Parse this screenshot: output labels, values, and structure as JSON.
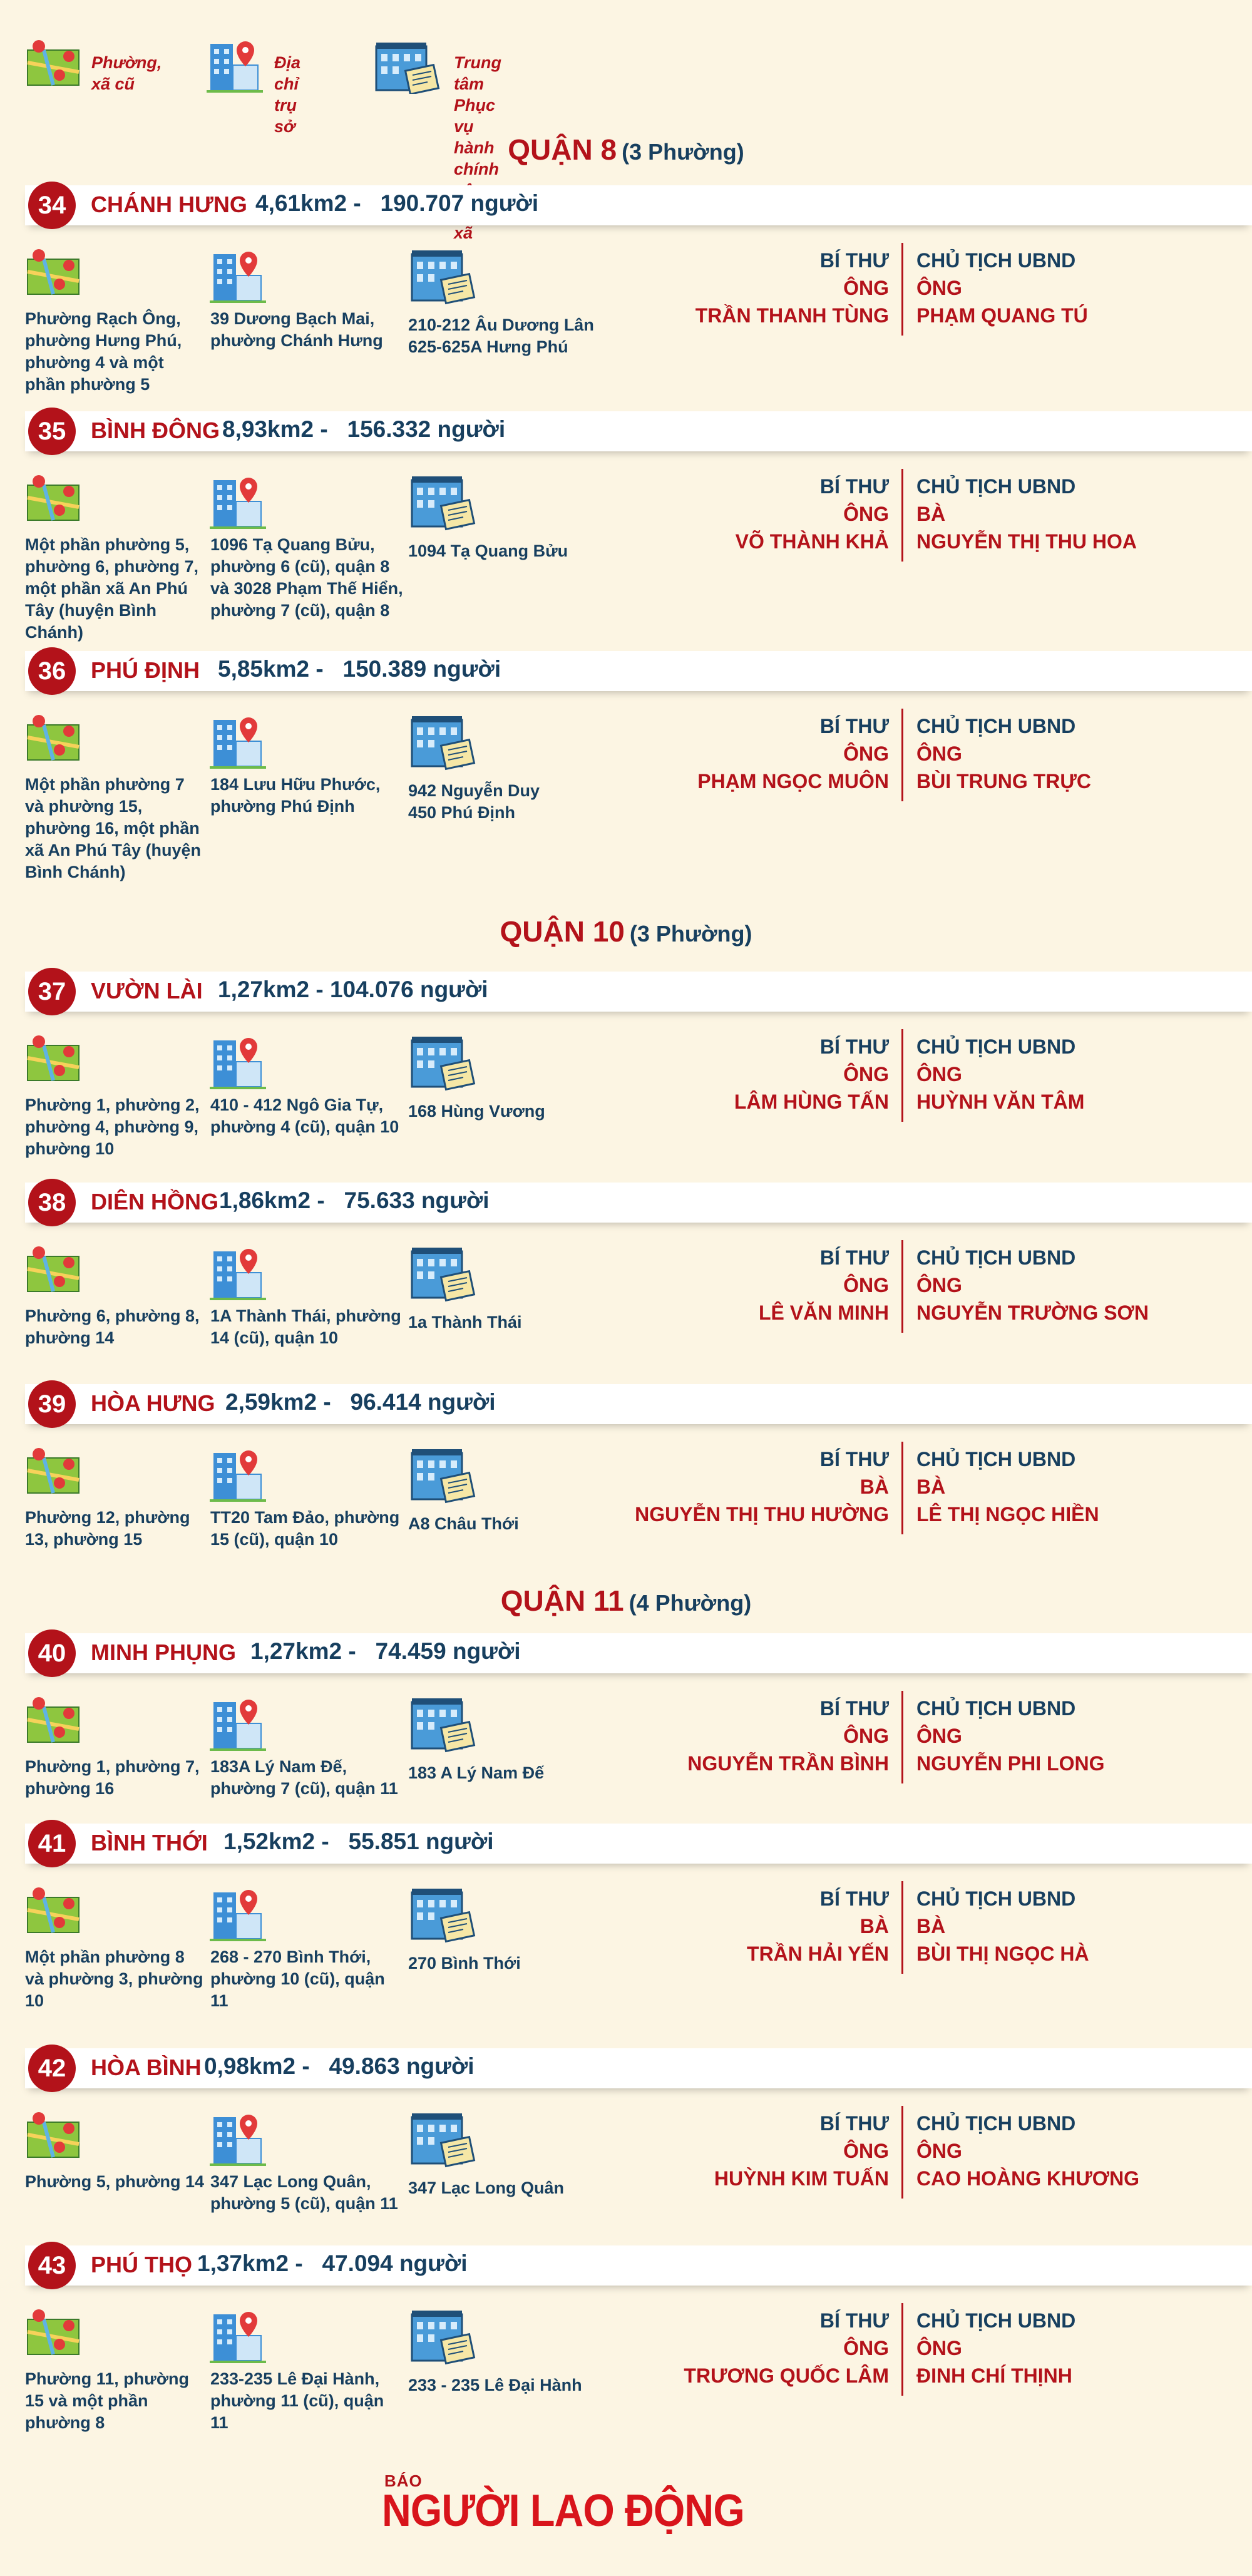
{
  "legend": {
    "old_label": "Phường,\nxã cũ",
    "office_label": "Địa chỉ\ntrụ sở",
    "center_label": "Trung tâm Phục vụ\nhành chính công cấp xã"
  },
  "districts": [
    {
      "name": "QUẬN 8",
      "count": "(3 Phường)"
    },
    {
      "name": "QUẬN 10",
      "count": "(3 Phường)"
    },
    {
      "name": "QUẬN 11",
      "count": "(4 Phường)"
    }
  ],
  "role_labels": {
    "secretary": "BÍ THƯ",
    "chair": "CHỦ TỊCH UBND"
  },
  "wards": [
    {
      "num": "34",
      "name": "CHÁNH HƯNG",
      "stats": "4,61km2 -   190.707 người",
      "old": "Phường Rạch Ông, phường Hưng Phú, phường 4 và một phần phường 5",
      "office": "39 Dương Bạch Mai, phường Chánh Hưng",
      "center": "210-212 Âu Dương Lân\n625-625A Hưng Phú",
      "sec_title": "ÔNG",
      "sec_name": "TRẦN THANH TÙNG",
      "chair_title": "ÔNG",
      "chair_name": "PHẠM QUANG TÚ"
    },
    {
      "num": "35",
      "name": "BÌNH ĐÔNG",
      "stats": "8,93km2 -   156.332 người",
      "old": "Một phần phường 5, phường 6, phường 7, một phần xã An Phú Tây (huyện Bình Chánh)",
      "office": "1096 Tạ Quang Bửu, phường 6 (cũ), quận 8 và 3028 Phạm Thế Hiển, phường 7 (cũ), quận 8",
      "center": "1094 Tạ Quang Bửu",
      "sec_title": "ÔNG",
      "sec_name": "VÕ THÀNH KHẢ",
      "chair_title": "BÀ",
      "chair_name": "NGUYỄN THỊ THU HOA"
    },
    {
      "num": "36",
      "name": "PHÚ ĐỊNH",
      "stats": "5,85km2 -   150.389 người",
      "old": "Một phần phường 7 và phường 15, phường 16, một phần xã An Phú Tây (huyện Bình Chánh)",
      "office": "184 Lưu Hữu Phước, phường Phú Định",
      "center": "942 Nguyễn Duy\n450 Phú Định",
      "sec_title": "ÔNG",
      "sec_name": "PHẠM NGỌC MUÔN",
      "chair_title": "ÔNG",
      "chair_name": "BÙI TRUNG TRỰC"
    },
    {
      "num": "37",
      "name": "VƯỜN LÀI",
      "stats": "1,27km2 - 104.076 người",
      "old": "Phường 1, phường 2, phường 4, phường 9, phường 10",
      "office": "410 - 412 Ngô Gia Tự, phường 4 (cũ), quận 10",
      "center": "168 Hùng Vương",
      "sec_title": "ÔNG",
      "sec_name": "LÂM HÙNG TẤN",
      "chair_title": "ÔNG",
      "chair_name": "HUỲNH VĂN TÂM"
    },
    {
      "num": "38",
      "name": "DIÊN HỒNG",
      "stats": "1,86km2 -   75.633 người",
      "old": "Phường 6, phường 8, phường 14",
      "office": "1A Thành Thái, phường 14 (cũ), quận 10",
      "center": "1a Thành Thái",
      "sec_title": "ÔNG",
      "sec_name": "LÊ VĂN MINH",
      "chair_title": "ÔNG",
      "chair_name": "NGUYỄN TRƯỜNG SƠN"
    },
    {
      "num": "39",
      "name": "HÒA HƯNG",
      "stats": "2,59km2 -   96.414 người",
      "old": "Phường 12, phường 13, phường 15",
      "office": "TT20 Tam Đảo, phường 15 (cũ), quận 10",
      "center": "A8 Châu Thới",
      "sec_title": "BÀ",
      "sec_name": "NGUYỄN THỊ THU HƯỜNG",
      "chair_title": "BÀ",
      "chair_name": "LÊ THỊ NGỌC HIỀN"
    },
    {
      "num": "40",
      "name": "MINH PHỤNG",
      "stats": "1,27km2 -   74.459 người",
      "old": "Phường 1, phường 7, phường 16",
      "office": "183A Lý Nam Đế, phường 7 (cũ), quận 11",
      "center": "183 A Lý Nam Đế",
      "sec_title": "ÔNG",
      "sec_name": "NGUYỄN TRẦN BÌNH",
      "chair_title": "ÔNG",
      "chair_name": "NGUYỄN PHI LONG"
    },
    {
      "num": "41",
      "name": "BÌNH THỚI",
      "stats": "1,52km2 -   55.851 người",
      "old": "Một phần phường 8 và phường 3, phường 10",
      "office": "268 - 270 Bình Thới, phường 10 (cũ), quận 11",
      "center": "270 Bình Thới",
      "sec_title": "BÀ",
      "sec_name": "TRẦN HẢI YẾN",
      "chair_title": "BÀ",
      "chair_name": "BÙI THỊ NGỌC HÀ"
    },
    {
      "num": "42",
      "name": "HÒA BÌNH",
      "stats": "0,98km2 -   49.863 người",
      "old": "Phường 5, phường 14",
      "office": "347 Lạc Long Quân, phường 5 (cũ), quận 11",
      "center": "347 Lạc Long Quân",
      "sec_title": "ÔNG",
      "sec_name": "HUỲNH KIM TUẤN",
      "chair_title": "ÔNG",
      "chair_name": "CAO HOÀNG KHƯƠNG"
    },
    {
      "num": "43",
      "name": "PHÚ THỌ",
      "stats": "1,37km2 -   47.094 người",
      "old": "Phường 11, phường 15 và một phần phường 8",
      "office": "233-235 Lê Đại Hành, phường 11 (cũ), quận 11",
      "center": "233 - 235 Lê Đại Hành",
      "sec_title": "ÔNG",
      "sec_name": "TRƯƠNG QUỐC LÂM",
      "chair_title": "ÔNG",
      "chair_name": "ĐINH CHÍ THỊNH"
    }
  ],
  "logo": {
    "small": "BÁO",
    "big": "NGƯỜI LAO ĐỘNG"
  }
}
